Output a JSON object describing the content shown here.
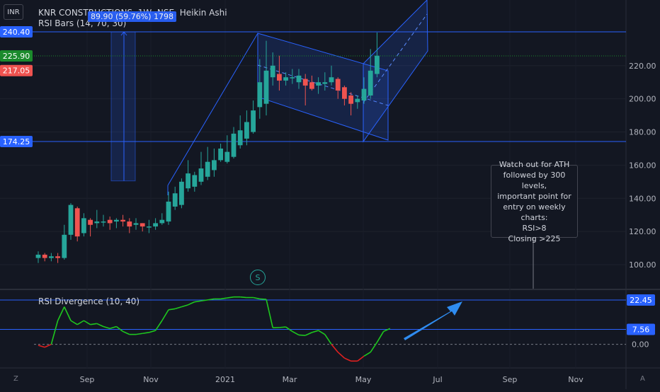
{
  "currency": "INR",
  "legend": {
    "symbol": "KNR CONSTRUCTIONS, 1W, NSE, Heikin Ashi",
    "indicator": "RSI Bars (14, 70, 30)"
  },
  "measure_label": "89.90 (59.76%) 1798",
  "rsi_legend": "RSI Divergence (10, 40)",
  "note_lines": [
    "Watch out for ATH",
    "followed by 300 levels,",
    "important point for",
    "entry on weekly charts:",
    "RSI>8",
    "Closing >225"
  ],
  "split_badge": "S",
  "corner_left": "Z",
  "corner_right": "A",
  "colors": {
    "up": "#26a69a",
    "down": "#ef5350",
    "line": "#2962ff",
    "rsi_up": "#1ec71e",
    "rsi_down": "#e02020",
    "accent_arrow": "#2f8cf0"
  },
  "chart_data": [
    {
      "type": "candlestick",
      "y_ticks": [
        100,
        120,
        140,
        160,
        180,
        200,
        220
      ],
      "ylim": [
        92,
        256
      ],
      "x_labels": [
        "Sep",
        "Nov",
        "2021",
        "Mar",
        "May",
        "Jul",
        "Sep",
        "Nov"
      ],
      "price_labels": [
        {
          "value": 240.4,
          "text": "240.40",
          "color": "#2962ff"
        },
        {
          "value": 225.9,
          "text": "225.90",
          "color": "#1b8a2c"
        },
        {
          "value": 217.05,
          "text": "217.05",
          "color": "#ef5350"
        },
        {
          "value": 174.25,
          "text": "174.25",
          "color": "#2962ff"
        }
      ],
      "horizontal_lines": [
        240.4,
        174.25
      ],
      "candles": [
        {
          "o": 104,
          "c": 106,
          "h": 108,
          "l": 101
        },
        {
          "o": 106,
          "c": 104,
          "h": 107,
          "l": 102
        },
        {
          "o": 104,
          "c": 105,
          "h": 107,
          "l": 102
        },
        {
          "o": 105,
          "c": 104,
          "h": 107,
          "l": 101
        },
        {
          "o": 104,
          "c": 118,
          "h": 124,
          "l": 103
        },
        {
          "o": 118,
          "c": 136,
          "h": 137,
          "l": 115
        },
        {
          "o": 134,
          "c": 117,
          "h": 135,
          "l": 114
        },
        {
          "o": 119,
          "c": 128,
          "h": 131,
          "l": 117
        },
        {
          "o": 127,
          "c": 124,
          "h": 128,
          "l": 117
        },
        {
          "o": 125,
          "c": 126,
          "h": 133,
          "l": 122
        },
        {
          "o": 126,
          "c": 126,
          "h": 130,
          "l": 123
        },
        {
          "o": 127,
          "c": 125,
          "h": 129,
          "l": 121
        },
        {
          "o": 126,
          "c": 127,
          "h": 128,
          "l": 122
        },
        {
          "o": 127,
          "c": 126,
          "h": 130,
          "l": 123
        },
        {
          "o": 126,
          "c": 123,
          "h": 128,
          "l": 119
        },
        {
          "o": 124,
          "c": 125,
          "h": 128,
          "l": 121
        },
        {
          "o": 125,
          "c": 123,
          "h": 125,
          "l": 120
        },
        {
          "o": 123,
          "c": 123,
          "h": 127,
          "l": 119
        },
        {
          "o": 123,
          "c": 125,
          "h": 128,
          "l": 121
        },
        {
          "o": 125,
          "c": 127,
          "h": 131,
          "l": 124
        },
        {
          "o": 126,
          "c": 138,
          "h": 144,
          "l": 124
        },
        {
          "o": 135,
          "c": 143,
          "h": 147,
          "l": 133
        },
        {
          "o": 136,
          "c": 150,
          "h": 152,
          "l": 134
        },
        {
          "o": 146,
          "c": 155,
          "h": 163,
          "l": 144
        },
        {
          "o": 147,
          "c": 154,
          "h": 156,
          "l": 144
        },
        {
          "o": 150,
          "c": 158,
          "h": 168,
          "l": 148
        },
        {
          "o": 153,
          "c": 162,
          "h": 171,
          "l": 151
        },
        {
          "o": 157,
          "c": 163,
          "h": 170,
          "l": 153
        },
        {
          "o": 163,
          "c": 170,
          "h": 173,
          "l": 162
        },
        {
          "o": 162,
          "c": 168,
          "h": 178,
          "l": 161
        },
        {
          "o": 165,
          "c": 179,
          "h": 183,
          "l": 164
        },
        {
          "o": 172,
          "c": 181,
          "h": 190,
          "l": 170
        },
        {
          "o": 176,
          "c": 186,
          "h": 193,
          "l": 172
        },
        {
          "o": 180,
          "c": 193,
          "h": 199,
          "l": 179
        },
        {
          "o": 195,
          "c": 210,
          "h": 224,
          "l": 188
        },
        {
          "o": 197,
          "c": 217,
          "h": 235,
          "l": 190
        },
        {
          "o": 213,
          "c": 220,
          "h": 228,
          "l": 208
        },
        {
          "o": 215,
          "c": 211,
          "h": 226,
          "l": 205
        },
        {
          "o": 211,
          "c": 213,
          "h": 216,
          "l": 208
        },
        {
          "o": 213,
          "c": 213,
          "h": 218,
          "l": 209
        },
        {
          "o": 210,
          "c": 214,
          "h": 218,
          "l": 206
        },
        {
          "o": 212,
          "c": 208,
          "h": 215,
          "l": 196
        },
        {
          "o": 210,
          "c": 206,
          "h": 214,
          "l": 205
        },
        {
          "o": 208,
          "c": 210,
          "h": 213,
          "l": 203
        },
        {
          "o": 209,
          "c": 210,
          "h": 216,
          "l": 205
        },
        {
          "o": 210,
          "c": 213,
          "h": 220,
          "l": 208
        },
        {
          "o": 212,
          "c": 205,
          "h": 213,
          "l": 200
        },
        {
          "o": 207,
          "c": 200,
          "h": 208,
          "l": 196
        },
        {
          "o": 202,
          "c": 197,
          "h": 204,
          "l": 190
        },
        {
          "o": 198,
          "c": 200,
          "h": 202,
          "l": 194
        },
        {
          "o": 199,
          "c": 206,
          "h": 213,
          "l": 197
        },
        {
          "o": 202,
          "c": 217,
          "h": 230,
          "l": 200
        },
        {
          "o": 215,
          "c": 226,
          "h": 240,
          "l": 213
        }
      ],
      "rsi_panel": {
        "y_ticks": [
          0
        ],
        "ylim": [
          -12,
          27
        ],
        "price_labels": [
          {
            "value": 22.45,
            "text": "22.45",
            "color": "#2962ff"
          },
          {
            "value": 7.56,
            "text": "7.56",
            "color": "#2962ff"
          }
        ],
        "horizontal_lines": [
          22.45,
          7.56
        ],
        "values": [
          -0.5,
          -1.5,
          0,
          12,
          19,
          12,
          10,
          12,
          10,
          10.5,
          9,
          8,
          9,
          6.5,
          5,
          5,
          5.5,
          6,
          7,
          12,
          17.5,
          18,
          19,
          20,
          21.5,
          22,
          22.5,
          23,
          23,
          23.5,
          24,
          24,
          23.7,
          23.7,
          23,
          22.8,
          8.4,
          8.5,
          8.8,
          6.5,
          4.7,
          4.5,
          6,
          7,
          5,
          0,
          -4,
          -7,
          -8.5,
          -8.5,
          -6,
          -4,
          1,
          6.5,
          8
        ]
      }
    }
  ]
}
